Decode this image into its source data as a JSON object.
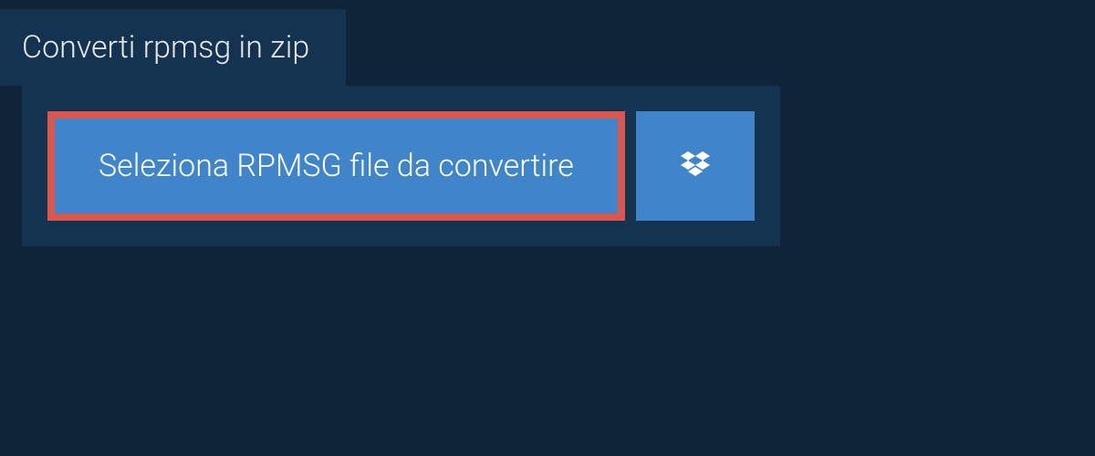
{
  "tab": {
    "label": "Converti rpmsg in zip"
  },
  "buttons": {
    "select_file_label": "Seleziona RPMSG file da convertire"
  },
  "colors": {
    "background": "#0f2438",
    "panel": "#143350",
    "button_primary": "#4085ca",
    "highlight_border": "#d9574e",
    "text_light": "#e8e8e8",
    "text_white": "#ffffff"
  },
  "icons": {
    "dropbox": "dropbox-icon"
  }
}
